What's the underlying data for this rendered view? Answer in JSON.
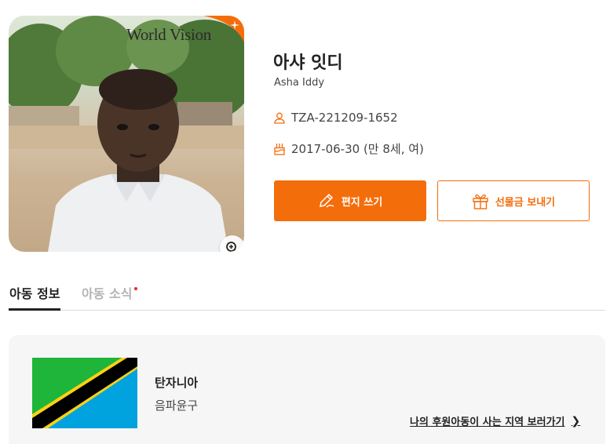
{
  "child": {
    "name_ko": "아샤 잇디",
    "name_en": "Asha Iddy",
    "id": "TZA-221209-1652",
    "birthday": "2017-06-30 (만 8세, 여)"
  },
  "photo": {
    "watermark": "World Vision"
  },
  "actions": {
    "letter_label": "편지 쓰기",
    "gift_label": "선물금 보내기"
  },
  "tabs": [
    {
      "label": "아동 정보",
      "active": true
    },
    {
      "label": "아동 소식",
      "active": false,
      "has_new": true
    }
  ],
  "country": {
    "name": "탄자니아",
    "region": "음파윤구",
    "link_label": "나의 후원아동이 사는 지역 보러가기"
  },
  "colors": {
    "accent": "#f46d0b",
    "new_dot": "#e8262d"
  },
  "icons": [
    "person-icon",
    "cake-icon",
    "pen-icon",
    "gift-icon",
    "zoom-in-icon",
    "chevron-right-icon"
  ]
}
